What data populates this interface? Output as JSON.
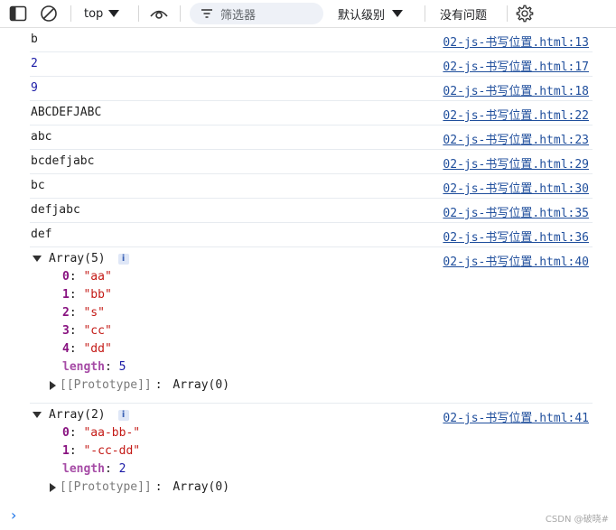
{
  "toolbar": {
    "context": "top",
    "filter_placeholder": "筛选器",
    "levels_label": "默认级别",
    "issues_label": "没有问题"
  },
  "logs": [
    {
      "msg": "b",
      "type": "string",
      "src": "02-js-书写位置.html:13"
    },
    {
      "msg": "2",
      "type": "number",
      "src": "02-js-书写位置.html:17"
    },
    {
      "msg": "9",
      "type": "number",
      "src": "02-js-书写位置.html:18"
    },
    {
      "msg": "ABCDEFJABC",
      "type": "string",
      "src": "02-js-书写位置.html:22"
    },
    {
      "msg": "abc",
      "type": "string",
      "src": "02-js-书写位置.html:23"
    },
    {
      "msg": "bcdefjabc",
      "type": "string",
      "src": "02-js-书写位置.html:29"
    },
    {
      "msg": "bc",
      "type": "string",
      "src": "02-js-书写位置.html:30"
    },
    {
      "msg": "defjabc",
      "type": "string",
      "src": "02-js-书写位置.html:35"
    },
    {
      "msg": "def",
      "type": "string",
      "src": "02-js-书写位置.html:36"
    }
  ],
  "arrays": [
    {
      "label": "Array(5)",
      "src": "02-js-书写位置.html:40",
      "items": [
        {
          "k": "0",
          "v": "\"aa\""
        },
        {
          "k": "1",
          "v": "\"bb\""
        },
        {
          "k": "2",
          "v": "\"s\""
        },
        {
          "k": "3",
          "v": "\"cc\""
        },
        {
          "k": "4",
          "v": "\"dd\""
        }
      ],
      "length_key": "length",
      "length": "5",
      "proto": "[[Prototype]]",
      "proto_val": "Array(0)"
    },
    {
      "label": "Array(2)",
      "src": "02-js-书写位置.html:41",
      "items": [
        {
          "k": "0",
          "v": "\"aa-bb-\""
        },
        {
          "k": "1",
          "v": "\"-cc-dd\""
        }
      ],
      "length_key": "length",
      "length": "2",
      "proto": "[[Prototype]]",
      "proto_val": "Array(0)"
    }
  ],
  "info_badge": "i",
  "prompt_glyph": "›",
  "watermark": "CSDN @破晓#",
  "colors": {
    "number": "#1a1aa6",
    "string_value": "#c41a16",
    "key": "#881280",
    "link": "#1f4e9c",
    "prompt": "#1a73e8"
  }
}
